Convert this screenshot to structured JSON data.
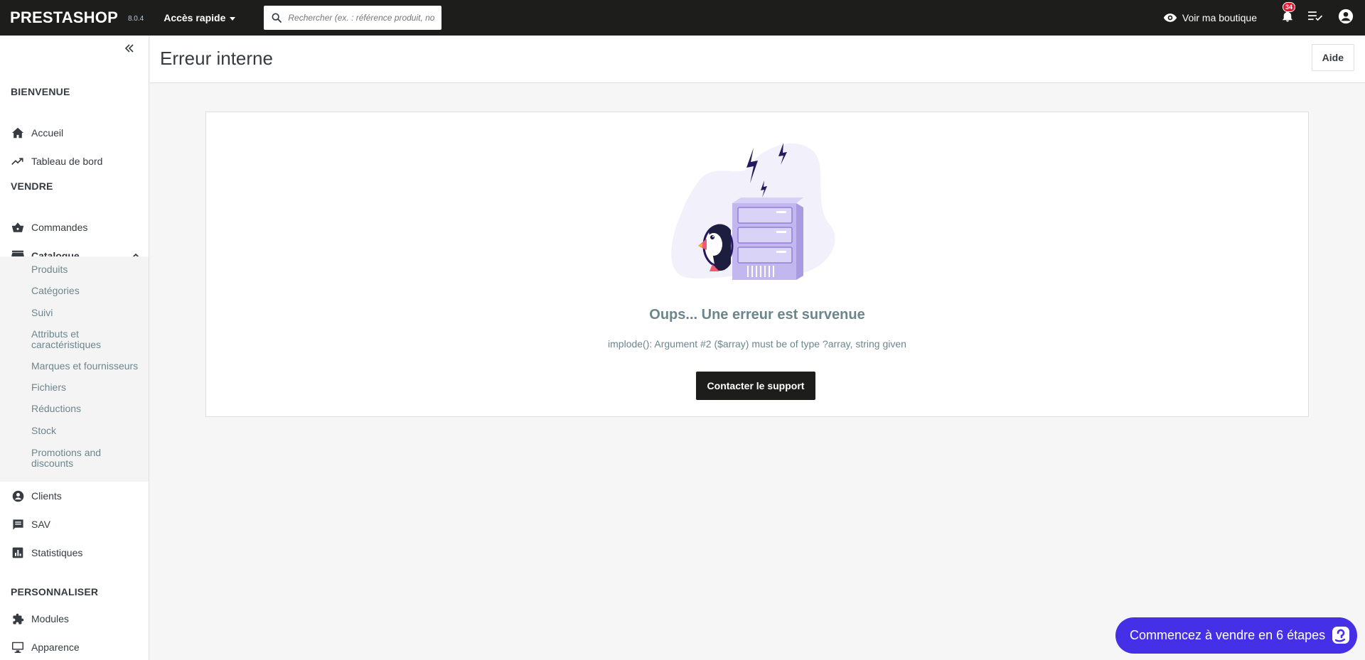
{
  "header": {
    "logo": "PRESTASHOP",
    "version": "8.0.4",
    "quick_access": "Accès rapide",
    "search_placeholder": "Rechercher (ex. : référence produit, no",
    "view_shop": "Voir ma boutique",
    "notification_count": "34",
    "icons": [
      "search-icon",
      "eye-icon",
      "bell-icon",
      "task-list-icon",
      "account-icon"
    ]
  },
  "sidebar": {
    "sections": {
      "welcome": "BIENVENUE",
      "sell": "VENDRE",
      "customize": "PERSONNALISER"
    },
    "items": {
      "home": "Accueil",
      "dashboard": "Tableau de bord",
      "orders": "Commandes",
      "catalog": "Catalogue",
      "customers": "Clients",
      "sav": "SAV",
      "stats": "Statistiques",
      "modules": "Modules",
      "appearance": "Apparence"
    },
    "catalog_sub": [
      "Produits",
      "Catégories",
      "Suivi",
      "Attributs et caractéristiques",
      "Marques et fournisseurs",
      "Fichiers",
      "Réductions",
      "Stock",
      "Promotions and discounts"
    ]
  },
  "page": {
    "title": "Erreur interne",
    "help_button": "Aide"
  },
  "error": {
    "title": "Oups... Une erreur est survenue",
    "message": "implode(): Argument #2 ($array) must be of type ?array, string given",
    "support_button": "Contacter le support"
  },
  "onboarding": {
    "label": "Commencez à vendre en 6 étapes"
  },
  "colors": {
    "topbar": "#1d1d1b",
    "onboarding": "#4530e8",
    "notification_badge": "#e0192e"
  }
}
